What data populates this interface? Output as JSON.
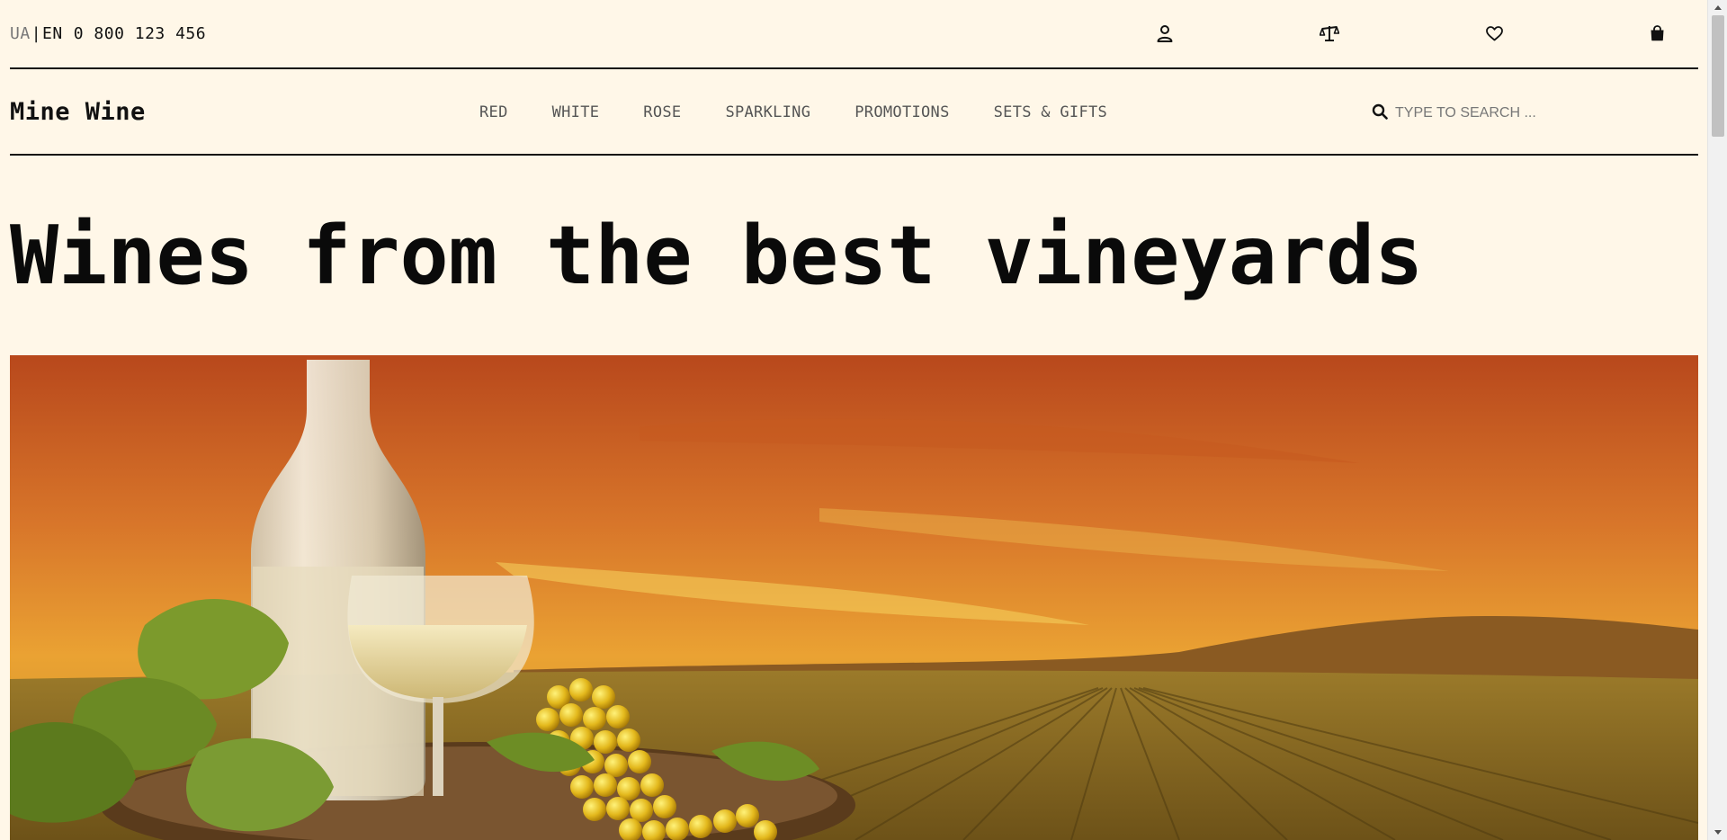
{
  "topbar": {
    "lang_ua": "UA",
    "lang_sep": "|",
    "lang_en": "EN",
    "phone": "0 800 123 456",
    "icons": [
      "user-icon",
      "compare-scale-icon",
      "heart-icon",
      "shopping-bag-icon"
    ]
  },
  "header": {
    "logo": "Mine Wine",
    "nav": [
      "RED",
      "WHITE",
      "ROSE",
      "SPARKLING",
      "PROMOTIONS",
      "SETS & GIFTS"
    ],
    "search_placeholder": "TYPE TO SEARCH ..."
  },
  "hero": {
    "title": "Wines from the best vineyards"
  },
  "colors": {
    "background": "#fff7e8",
    "text": "#111111",
    "nav_text": "#555555",
    "sky_top": "#c2551c",
    "sky_mid": "#e89a2a",
    "field": "#8a6a1f"
  }
}
